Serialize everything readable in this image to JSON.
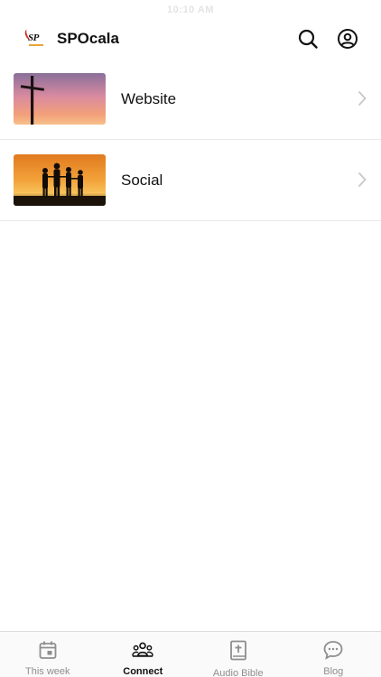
{
  "status_bar": {
    "time": "10:10 AM"
  },
  "header": {
    "logo_text": "SP",
    "title": "SPOcala",
    "search_icon": "search-icon",
    "account_icon": "account-icon"
  },
  "list": {
    "items": [
      {
        "label": "Website",
        "thumbnail": "cross-sunset-image"
      },
      {
        "label": "Social",
        "thumbnail": "family-sunset-image"
      }
    ]
  },
  "tabbar": {
    "tabs": [
      {
        "label": "This week",
        "icon": "calendar-icon",
        "active": false
      },
      {
        "label": "Connect",
        "icon": "people-icon",
        "active": true
      },
      {
        "label": "Audio Bible",
        "icon": "bible-icon",
        "active": false
      },
      {
        "label": "Blog",
        "icon": "chat-bubble-icon",
        "active": false
      }
    ]
  },
  "colors": {
    "active_tab": "#111111",
    "inactive_tab": "#8e8e8e",
    "divider": "#e9e9e9",
    "chevron": "#c7c7cc"
  }
}
